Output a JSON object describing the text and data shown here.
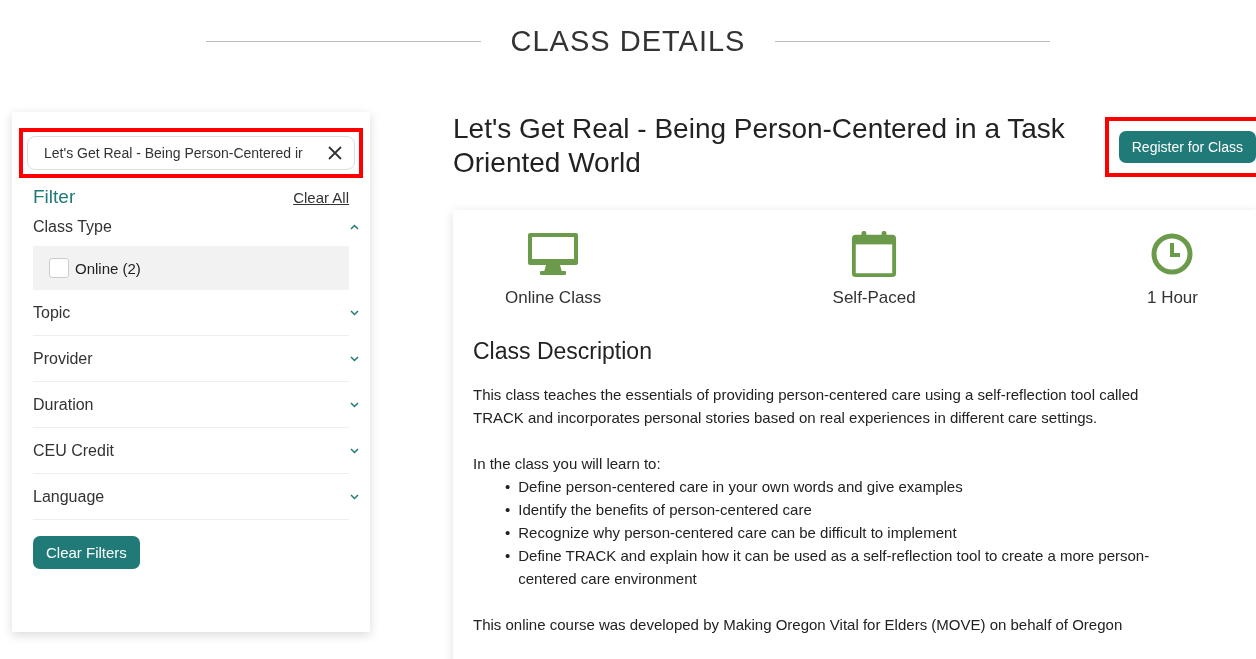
{
  "page_title": "CLASS DETAILS",
  "search": {
    "value": "Let's Get Real - Being Person-Centered ir",
    "highlighted": true
  },
  "filter": {
    "title": "Filter",
    "clear_all": "Clear All",
    "groups": [
      {
        "label": "Class Type",
        "expanded": true,
        "options": [
          {
            "label": "Online (2)",
            "checked": false
          }
        ]
      },
      {
        "label": "Topic",
        "expanded": false
      },
      {
        "label": "Provider",
        "expanded": false
      },
      {
        "label": "Duration",
        "expanded": false
      },
      {
        "label": "CEU Credit",
        "expanded": false
      },
      {
        "label": "Language",
        "expanded": false
      }
    ],
    "clear_button": "Clear Filters"
  },
  "class": {
    "title": "Let's Get Real - Being Person-Centered in a Task Oriented World",
    "register_button": {
      "label": "Register for Class",
      "highlighted": true
    },
    "features": [
      {
        "kind": "monitor",
        "label": "Online Class"
      },
      {
        "kind": "calendar",
        "label": "Self-Paced"
      },
      {
        "kind": "clock",
        "label": "1 Hour"
      }
    ],
    "description_title": "Class Description",
    "intro": "This class teaches the essentials of providing person-centered care using a self-reflection tool called TRACK and incorporates personal stories based on real experiences in different care settings.",
    "learn_heading": "In the class you will learn to:",
    "objectives": [
      {
        "bullet": "•",
        "text": "Define person-centered care in your own words and give examples"
      },
      {
        "bullet": "•",
        "text": "Identify the benefits of person-centered care"
      },
      {
        "bullet": "•",
        "text": "Recognize why person-centered care can be difficult to implement"
      },
      {
        "bullet": "•",
        "text": "Define TRACK and explain how it can be used as a self-reflection tool to create a more person-centered care environment"
      }
    ],
    "closing": "This online course was developed by Making Oregon Vital for Elders (MOVE) on behalf of Oregon"
  }
}
